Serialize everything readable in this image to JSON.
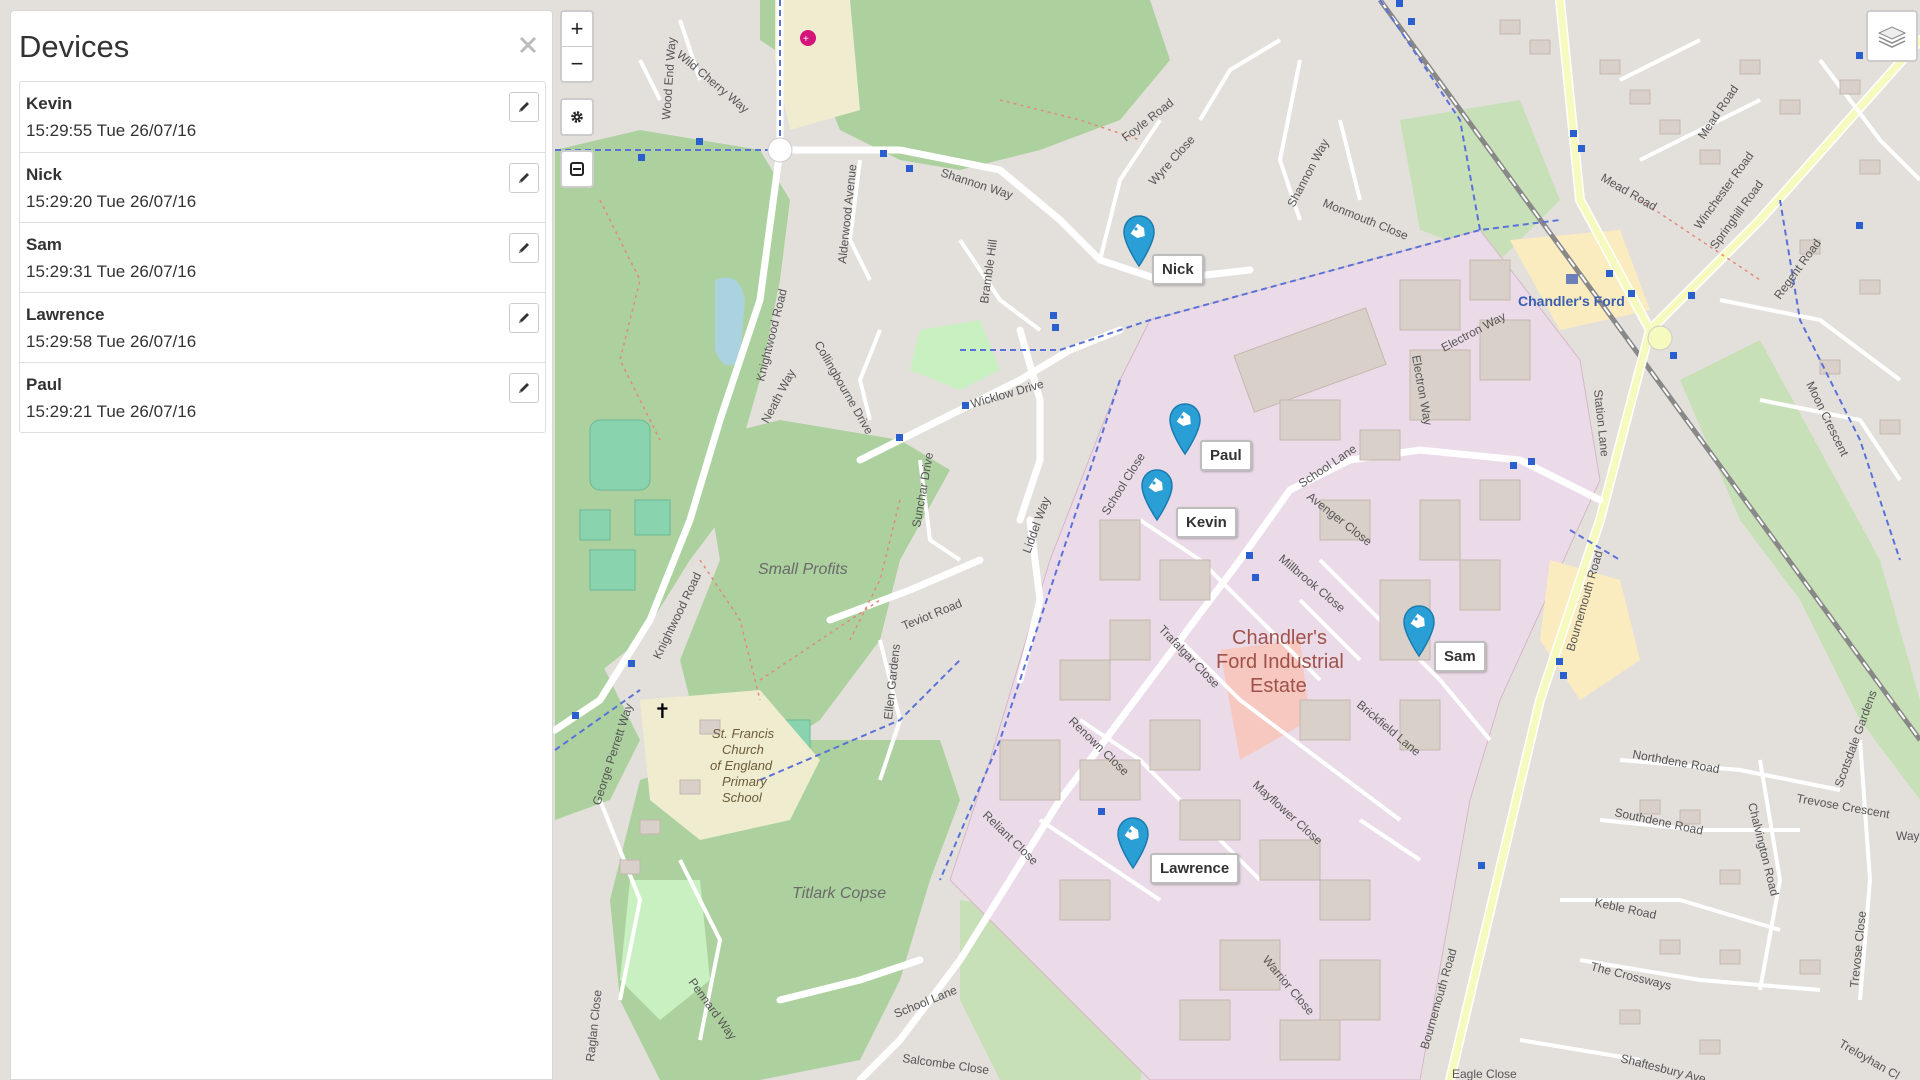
{
  "sidebar": {
    "title": "Devices",
    "close_icon": "close-icon",
    "devices": [
      {
        "name": "Kevin",
        "time": "15:29:55 Tue 26/07/16"
      },
      {
        "name": "Nick",
        "time": "15:29:20 Tue 26/07/16"
      },
      {
        "name": "Sam",
        "time": "15:29:31 Tue 26/07/16"
      },
      {
        "name": "Lawrence",
        "time": "15:29:58 Tue 26/07/16"
      },
      {
        "name": "Paul",
        "time": "15:29:21 Tue 26/07/16"
      }
    ],
    "edit_icon": "pencil-icon"
  },
  "map_controls": {
    "zoom_in": "+",
    "zoom_out": "−",
    "settings_icon": "gear-icon",
    "panel_icon": "panel-toggle-icon",
    "layers_icon": "layers-icon"
  },
  "markers": [
    "Nick",
    "Paul",
    "Kevin",
    "Sam",
    "Lawrence"
  ],
  "map_labels": {
    "small_profits": "Small Profits",
    "titlark_copse": "Titlark Copse",
    "industrial_1": "Chandler's",
    "industrial_2": "Ford Industrial",
    "industrial_3": "Estate",
    "school_1": "St. Francis",
    "school_2": "Church",
    "school_3": "of England",
    "school_4": "Primary",
    "school_5": "School",
    "chandlers_ford": "Chandler's Ford",
    "shannon_way": "Shannon Way",
    "wicklow_drive": "Wicklow Drive",
    "teviot_road": "Teviot Road",
    "school_lane": "School Lane",
    "school_lane_2": "School Lane",
    "electron_way": "Electron Way",
    "electron_way_2": "Electron Way",
    "monmouth_close": "Monmouth Close",
    "avenger_close": "Avenger Close",
    "millbrook_close": "Millbrook Close",
    "trafalgar_close": "Trafalgar Close",
    "renown_close": "Renown Close",
    "reliant_close": "Reliant Close",
    "mayflower_close": "Mayflower Close",
    "brickfield_lane": "Brickfield Lane",
    "warrior_close": "Warrior Close",
    "bournemouth_road": "Bournemouth Road",
    "bournemouth_road_2": "Bournemouth Road",
    "northdene_road": "Northdene Road",
    "southdene_road": "Southdene Road",
    "keble_road": "Keble Road",
    "the_crossways": "The Crossways",
    "trevose_crescent": "Trevose Crescent",
    "knightwood_road": "Knightwood Road",
    "knightwood_road_2": "Knightwood Road",
    "collingbourne_drive": "Collingbourne Drive",
    "ellen_gardens": "Ellen Gardens",
    "sunchar_drive": "Sunchar Drive",
    "liddel_way": "Liddel Way",
    "school_close": "School Close",
    "foyle_road": "Foyle Road",
    "wyre_close": "Wyre Close",
    "shannon_way_2": "Shannon Way",
    "station_lane": "Station Lane",
    "mead_road": "Mead Road",
    "winchester_road": "Winchester Road",
    "springhill_road": "Springhill Road",
    "regent_road": "Regent Road",
    "moon_crescent": "Moon Crescent",
    "chalvington_road": "Chalvington Road",
    "shaftesbury_avenue": "Shaftesbury Ave",
    "treloyhan_close": "Treloyhan Cl",
    "eagle_close": "Eagle Close",
    "salcombe_close": "Salcombe Close",
    "penhurst_way": "Pennard Way",
    "raglan_close": "Raglan Close",
    "george_perrett_way": "George Perrett Way",
    "nelson_way": "Neath Way",
    "bramble_hill": "Bramble Hill",
    "alderwood_avenue": "Alderwood Avenue",
    "wood_end_way": "Wood End Way",
    "wild_cherry_way": "Wild Cherry Way",
    "manor_road": "Mead Road",
    "scotsdale_gardens": "Scotsdale Gardens",
    "trevose_close": "Trevose Close",
    "way": "Way",
    "school_lane_3": "School Lane"
  }
}
